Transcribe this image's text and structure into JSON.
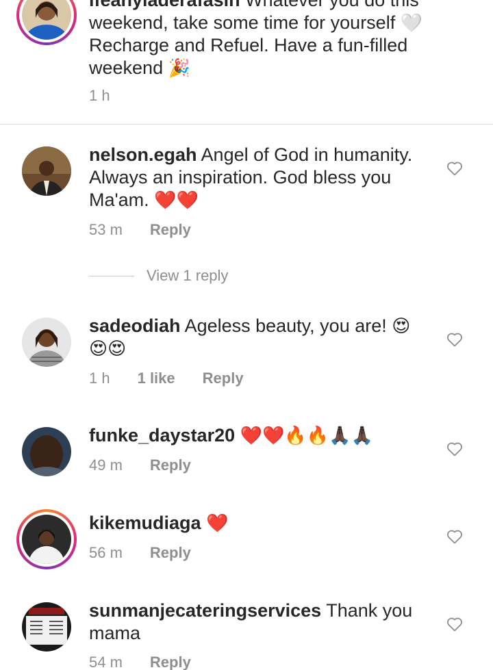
{
  "caption": {
    "username": "ifeanyiaderafasin",
    "text": "Whatever you do this weekend, take some time for yourself",
    "text2": "Recharge and Refuel. Have a fun-filled weekend",
    "emoji1": "🤍",
    "emoji2": "🎉",
    "time": "1 h"
  },
  "comments": [
    {
      "username": "nelson.egah",
      "text": "Angel of God in humanity. Always an inspiration. God bless you Ma'am.",
      "emoji": "❤️❤️",
      "time": "53 m",
      "reply": "Reply",
      "view_replies": "View 1 reply"
    },
    {
      "username": "sadeodiah",
      "text": "Ageless beauty, you are!",
      "emoji": "😍",
      "emoji_line2": "😍😍",
      "time": "1 h",
      "likes": "1 like",
      "reply": "Reply"
    },
    {
      "username": "funke_daystar20",
      "emoji": "❤️❤️🔥🔥🙏🏿🙏🏿",
      "time": "49 m",
      "reply": "Reply"
    },
    {
      "username": "kikemudiaga",
      "emoji": "❤️",
      "time": "56 m",
      "reply": "Reply"
    },
    {
      "username": "sunmanjecateringservices",
      "text": "Thank you mama",
      "time": "54 m",
      "reply": "Reply"
    }
  ],
  "colors": {
    "text": "#262626",
    "secondary": "#8e8e8e",
    "divider": "#dbdbdb",
    "heart_red": "#ed4956"
  },
  "icons": [
    "heart-outline-icon"
  ]
}
